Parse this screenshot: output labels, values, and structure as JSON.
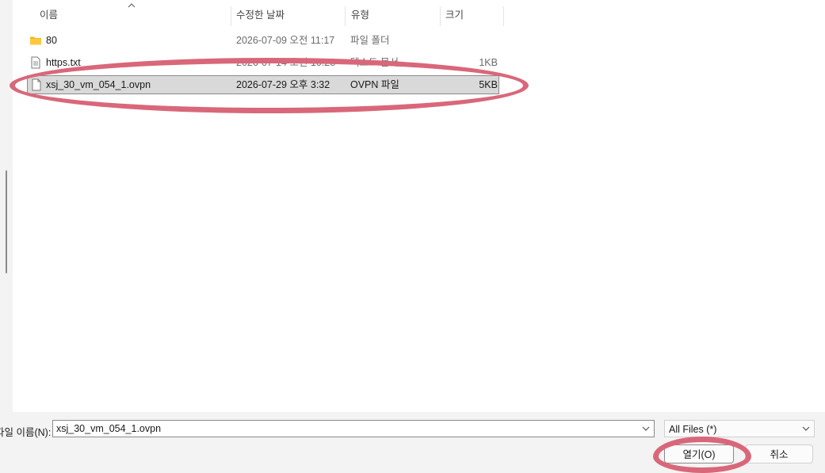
{
  "columns": {
    "name": "이름",
    "modified": "수정한 날짜",
    "type": "유형",
    "size": "크기"
  },
  "files": [
    {
      "name": "80",
      "modified": "2026-07-09 오전 11:17",
      "type": "파일 폴더",
      "size": "",
      "icon": "folder-icon"
    },
    {
      "name": "https.txt",
      "modified": "2026-07-14 오전 10:28",
      "type": "텍스트 문서",
      "size": "1KB",
      "icon": "text-file-icon"
    },
    {
      "name": "xsj_30_vm_054_1.ovpn",
      "modified": "2026-07-29 오후 3:32",
      "type": "OVPN 파일",
      "size": "5KB",
      "icon": "file-icon",
      "selected": true
    }
  ],
  "footer": {
    "filename_label": "파일 이름(N):",
    "filename_value": "xsj_30_vm_054_1.ovpn",
    "file_type": "All Files (*)",
    "open_label": "열기(O)",
    "cancel_label": "취소"
  },
  "colors": {
    "annotation": "#d9677a",
    "selection": "#d9d9d9"
  }
}
